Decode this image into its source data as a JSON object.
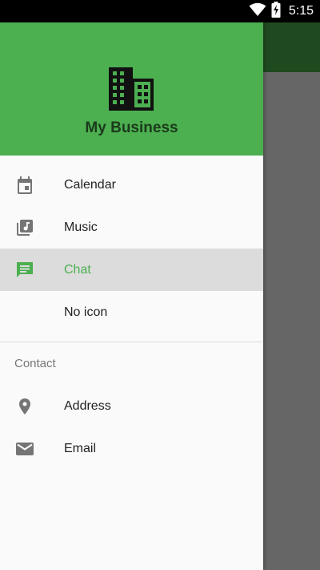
{
  "status_bar": {
    "time": "5:15",
    "icons": [
      "wifi-icon",
      "battery-charging-icon"
    ]
  },
  "drawer": {
    "header": {
      "title": "My Business",
      "logo_icon": "building-icon"
    },
    "items": [
      {
        "label": "Calendar",
        "icon": "calendar-icon",
        "active": false
      },
      {
        "label": "Music",
        "icon": "music-library-icon",
        "active": false
      },
      {
        "label": "Chat",
        "icon": "chat-icon",
        "active": true
      },
      {
        "label": "No icon",
        "icon": "",
        "active": false
      }
    ],
    "section": {
      "title": "Contact",
      "items": [
        {
          "label": "Address",
          "icon": "location-pin-icon"
        },
        {
          "label": "Email",
          "icon": "email-icon"
        }
      ]
    }
  },
  "colors": {
    "primary": "#4caf50",
    "active_background": "#dcdcdc",
    "scrim": "#666666"
  }
}
